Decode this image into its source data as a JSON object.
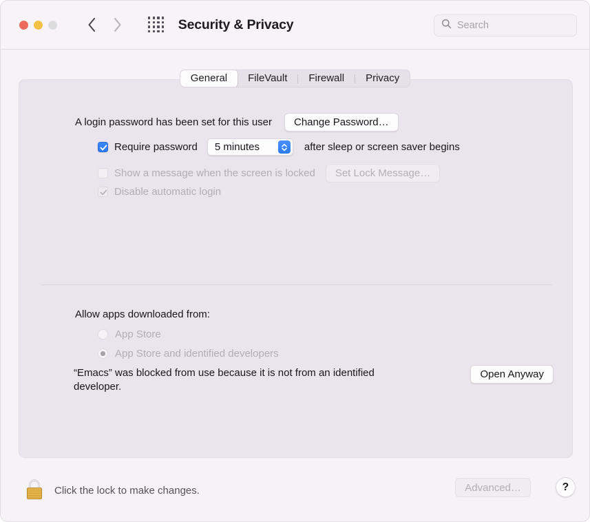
{
  "window": {
    "title": "Security & Privacy",
    "traffic_lights": [
      "close",
      "minimize",
      "zoom"
    ]
  },
  "toolbar": {
    "back_icon": "chevron-left-icon",
    "forward_icon": "chevron-right-icon",
    "grid_icon": "grid-view-icon",
    "search": {
      "placeholder": "Search",
      "value": "",
      "icon": "search-icon"
    }
  },
  "tabs": [
    {
      "label": "General",
      "active": true
    },
    {
      "label": "FileVault",
      "active": false
    },
    {
      "label": "Firewall",
      "active": false
    },
    {
      "label": "Privacy",
      "active": false
    }
  ],
  "general": {
    "login_password_text": "A login password has been set for this user",
    "change_password_label": "Change Password…",
    "require_password": {
      "checked": true,
      "label": "Require password",
      "delay_value": "5 minutes",
      "suffix": "after sleep or screen saver begins"
    },
    "show_message": {
      "checked": false,
      "disabled": true,
      "label": "Show a message when the screen is locked",
      "button_label": "Set Lock Message…"
    },
    "disable_automatic_login": {
      "checked": true,
      "disabled": true,
      "label": "Disable automatic login"
    }
  },
  "gatekeeper": {
    "section_title": "Allow apps downloaded from:",
    "options": [
      {
        "label": "App Store",
        "selected": false,
        "disabled": true
      },
      {
        "label": "App Store and identified developers",
        "selected": true,
        "disabled": true
      }
    ],
    "blocked_message": "“Emacs” was blocked from use because it is not from an identified developer.",
    "open_anyway_label": "Open Anyway"
  },
  "footer": {
    "lock_icon": "padlock-closed-icon",
    "lock_caption": "Click the lock to make changes.",
    "advanced_label": "Advanced…",
    "advanced_disabled": true,
    "help_label": "?"
  },
  "colors": {
    "accent_blue": "#2d7cf6",
    "window_bg": "#f6f3f6",
    "panel_bg": "#eae5ec",
    "lock_gold": "#e8b84b"
  }
}
